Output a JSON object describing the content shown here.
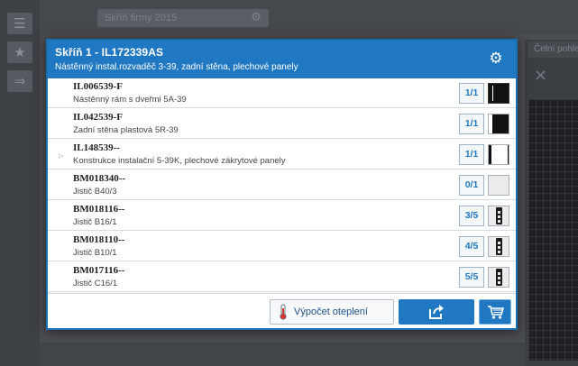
{
  "app": {
    "left_rail_icons": [
      "list-icon",
      "star-icon",
      "arrow-right-icon"
    ],
    "top_field_text": "Skříň firmy 2015",
    "right_tab_label": "Čelní pohled"
  },
  "dialog": {
    "title": "Skříň 1 - IL172339AS",
    "subtitle": "Nástěnný instal.rozvaděč 3-39, zadní stěna, plechové panely",
    "items": [
      {
        "code": "IL006539-F",
        "description": "Nástěnný rám s dveřmi 5A-39",
        "count": "1/1",
        "thumb": "panel-dark",
        "expandable": false
      },
      {
        "code": "IL042539-F",
        "description": "Zadní stěna plastová 5R-39",
        "count": "1/1",
        "thumb": "panel-split",
        "expandable": false
      },
      {
        "code": "IL148539--",
        "description": "Konstrukce instalační 5-39K, plechové zákrytové panely",
        "count": "1/1",
        "thumb": "panel-light",
        "expandable": true
      },
      {
        "code": "BM018340--",
        "description": "Jistič  B40/3",
        "count": "0/1",
        "thumb": "empty",
        "expandable": false
      },
      {
        "code": "BM018116--",
        "description": "Jistič  B16/1",
        "count": "3/5",
        "thumb": "breaker",
        "expandable": false
      },
      {
        "code": "BM018110--",
        "description": "Jistič  B10/1",
        "count": "4/5",
        "thumb": "breaker",
        "expandable": false
      },
      {
        "code": "BM017116--",
        "description": "Jistič  C16/1",
        "count": "5/5",
        "thumb": "breaker",
        "expandable": false
      }
    ],
    "buttons": {
      "heat_calc_label": "Výpočet oteplení"
    }
  },
  "colors": {
    "accent": "#1f78c1",
    "background": "#4a4d52"
  }
}
